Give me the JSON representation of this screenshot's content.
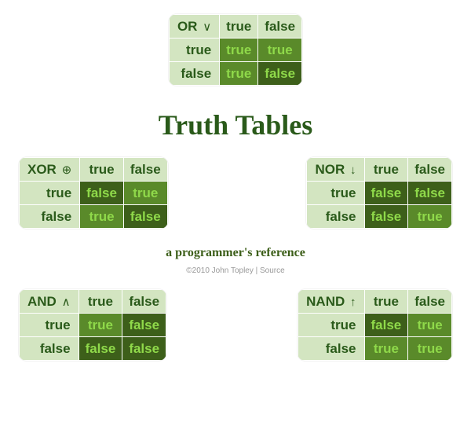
{
  "title": "Truth Tables",
  "subtitle": "a programmer's reference",
  "credit": "©2010 John Topley | Source",
  "labels": {
    "true": "true",
    "false": "false"
  },
  "tables": {
    "or": {
      "name": "OR",
      "sym": "∨",
      "tt": "true",
      "tf": "true",
      "ft": "true",
      "ff": "false"
    },
    "xor": {
      "name": "XOR",
      "sym": "⊕",
      "tt": "false",
      "tf": "true",
      "ft": "true",
      "ff": "false"
    },
    "nor": {
      "name": "NOR",
      "sym": "↓",
      "tt": "false",
      "tf": "false",
      "ft": "false",
      "ff": "true"
    },
    "and": {
      "name": "AND",
      "sym": "∧",
      "tt": "true",
      "tf": "false",
      "ft": "false",
      "ff": "false"
    },
    "nand": {
      "name": "NAND",
      "sym": "↑",
      "tt": "false",
      "tf": "true",
      "ft": "true",
      "ff": "true"
    }
  },
  "chart_data": [
    {
      "type": "table",
      "operator": "OR",
      "symbol": "∨",
      "rows": [
        [
          "true",
          "true",
          "true"
        ],
        [
          "true",
          "false",
          "true"
        ],
        [
          "false",
          "true",
          "true"
        ],
        [
          "false",
          "false",
          "false"
        ]
      ]
    },
    {
      "type": "table",
      "operator": "XOR",
      "symbol": "⊕",
      "rows": [
        [
          "true",
          "true",
          "false"
        ],
        [
          "true",
          "false",
          "true"
        ],
        [
          "false",
          "true",
          "true"
        ],
        [
          "false",
          "false",
          "false"
        ]
      ]
    },
    {
      "type": "table",
      "operator": "NOR",
      "symbol": "↓",
      "rows": [
        [
          "true",
          "true",
          "false"
        ],
        [
          "true",
          "false",
          "false"
        ],
        [
          "false",
          "true",
          "false"
        ],
        [
          "false",
          "false",
          "true"
        ]
      ]
    },
    {
      "type": "table",
      "operator": "AND",
      "symbol": "∧",
      "rows": [
        [
          "true",
          "true",
          "true"
        ],
        [
          "true",
          "false",
          "false"
        ],
        [
          "false",
          "true",
          "false"
        ],
        [
          "false",
          "false",
          "false"
        ]
      ]
    },
    {
      "type": "table",
      "operator": "NAND",
      "symbol": "↑",
      "rows": [
        [
          "true",
          "true",
          "false"
        ],
        [
          "true",
          "false",
          "true"
        ],
        [
          "false",
          "true",
          "true"
        ],
        [
          "false",
          "false",
          "true"
        ]
      ]
    }
  ]
}
